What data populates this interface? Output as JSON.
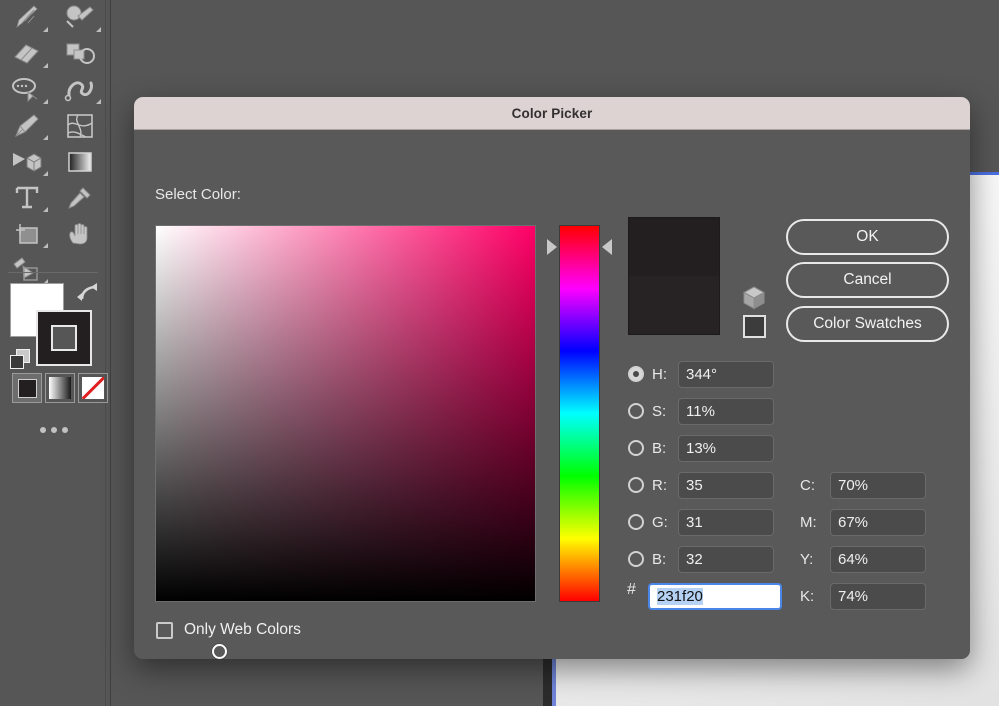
{
  "dialog": {
    "title": "Color Picker",
    "select_color_label": "Select Color:",
    "buttons": {
      "ok": "OK",
      "cancel": "Cancel",
      "color_swatches": "Color Swatches"
    },
    "hex_symbol": "#",
    "only_web_colors_label": "Only Web Colors",
    "only_web_colors_checked": false
  },
  "color": {
    "hex": "231f20",
    "preview_new": "#231f20",
    "preview_current": "#272324",
    "hue_accent": "#ff0066",
    "focus_border": "#4a86e8",
    "selection_highlight": "#b5d2f5"
  },
  "fields": {
    "hsb": [
      {
        "name": "hue",
        "label": "H:",
        "value": "344°",
        "selected": true
      },
      {
        "name": "saturation",
        "label": "S:",
        "value": "11%",
        "selected": false
      },
      {
        "name": "brightness",
        "label": "B:",
        "value": "13%",
        "selected": false
      }
    ],
    "rgb": [
      {
        "name": "red",
        "label": "R:",
        "value": "35",
        "selected": false
      },
      {
        "name": "green",
        "label": "G:",
        "value": "31",
        "selected": false
      },
      {
        "name": "blue",
        "label": "B:",
        "value": "32",
        "selected": false
      }
    ],
    "cmyk": [
      {
        "name": "cyan",
        "label": "C:",
        "value": "70%"
      },
      {
        "name": "magenta",
        "label": "M:",
        "value": "67%"
      },
      {
        "name": "yellow",
        "label": "Y:",
        "value": "64%"
      },
      {
        "name": "black",
        "label": "K:",
        "value": "74%"
      }
    ]
  },
  "toolbar": {
    "tools": [
      "pencil-tool",
      "paintbrush-tool",
      "eraser-tool",
      "shaper-tool",
      "lasso-tool",
      "blob-brush-tool",
      "pen-tool",
      "mesh-tool",
      "perspective-tool",
      "gradient-tool",
      "type-tool",
      "eyedropper-tool",
      "artboard-tool",
      "hand-tool",
      "live-paint-bucket-tool",
      "live-paint-selection-tool"
    ],
    "fill_color": "#ffffff",
    "stroke_color": "#231f20",
    "fill_modes": [
      "solid-color",
      "gradient",
      "none"
    ],
    "more_tools_label": "..."
  }
}
